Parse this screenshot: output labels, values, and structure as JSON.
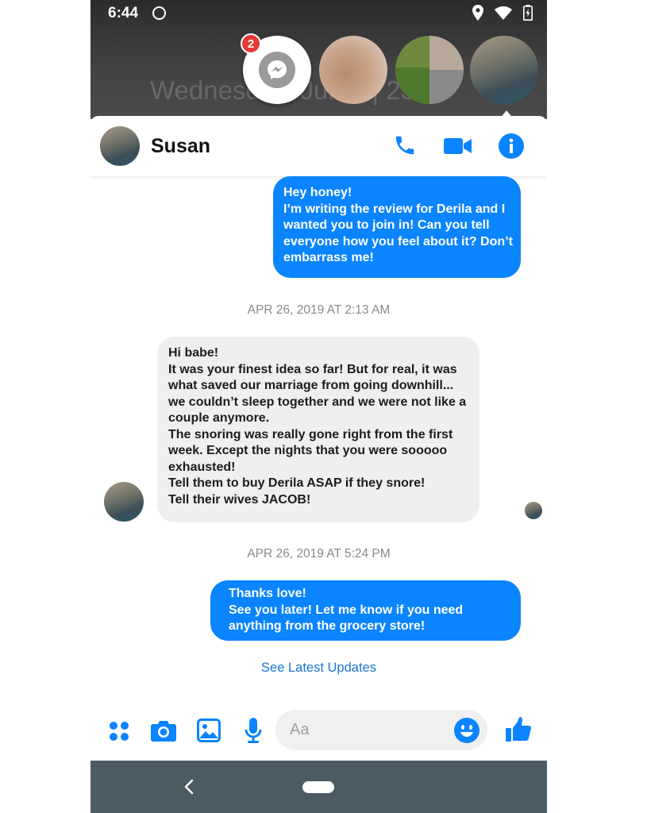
{
  "status_bar": {
    "time": "6:44"
  },
  "background": {
    "lock_date": "Wednesday, Jun 1 | 23°F"
  },
  "chat_heads": {
    "unread_badge": "2"
  },
  "header": {
    "contact_name": "Susan"
  },
  "messages": [
    {
      "direction": "outgoing",
      "text": "Hey honey!\nI’m writing the review for Derila and I wanted you to join in! Can you tell everyone how you feel about it? Don’t embarrass me!"
    },
    {
      "direction": "incoming",
      "text": "Hi babe!\nIt was your finest idea so far! But for real, it was what saved our marriage from going downhill... we couldn’t sleep together and we were not like a couple anymore.\nThe snoring was really gone right from the first week. Except the nights that you were sooooo exhausted!\nTell them to buy Derila ASAP if they snore!\nTell their wives JACOB!"
    },
    {
      "direction": "outgoing",
      "text": "Thanks love!\nSee you later! Let me know if you need anything from the grocery store!"
    }
  ],
  "timestamps": [
    "APR 26, 2019 AT 2:13 AM",
    "APR 26, 2019 AT 5:24 PM"
  ],
  "see_latest": "See Latest Updates",
  "composer": {
    "placeholder": "Aa"
  },
  "colors": {
    "accent": "#0a84ff",
    "link": "#1877d2",
    "incoming_bubble": "#efefef",
    "nav_bar": "#4b5b63"
  },
  "icons": [
    "messenger-icon",
    "location-icon",
    "wifi-icon",
    "battery-icon",
    "phone-icon",
    "video-icon",
    "info-icon",
    "apps-icon",
    "camera-icon",
    "image-icon",
    "mic-icon",
    "emoji-icon",
    "like-icon",
    "back-icon",
    "home-pill"
  ]
}
